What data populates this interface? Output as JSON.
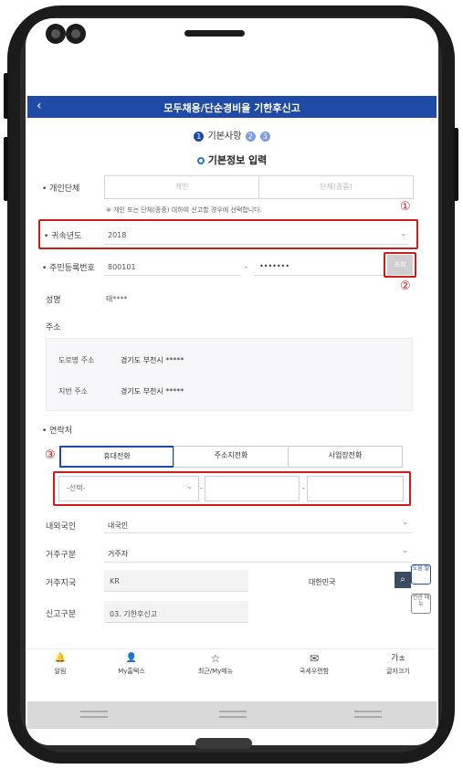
{
  "appbar": {
    "back_icon": "‹",
    "title": "모두채용/단순경비율 기한후신고"
  },
  "stepper": {
    "label": "기본사항",
    "step1": "1",
    "step2": "2",
    "step3": "3"
  },
  "section": {
    "title": "기본정보 입력"
  },
  "form": {
    "type_label": "• 개인단체",
    "type_options": [
      "개인",
      "단체(종중)"
    ],
    "type_note": "※ 개인 또는 단체(종중) 대하여 신고할 경우에 선택합니다.",
    "year_label": "• 귀속년도",
    "year_value": "2018",
    "rrn_label": "• 주민등록번호",
    "rrn_front": "800101",
    "rrn_dash": "-",
    "rrn_back": "•••••••",
    "rrn_button": "조회",
    "name_label": "성명",
    "name_value": "태****",
    "addr_label": "주소",
    "road_label": "도로명 주소",
    "road_value": "경기도 부천시 *****",
    "jibun_label": "지번 주소",
    "jibun_value": "경기도 부천시 *****",
    "contact_label": "• 연락처",
    "contact_tabs": [
      "휴대전화",
      "주소지전화",
      "사업장전화"
    ],
    "phone_select": "-선택-",
    "phone_sep1": "-",
    "phone_sep2": "-",
    "nation_label": "내외국인",
    "nation_value": "내국인",
    "residence_label": "거주구분",
    "residence_value": "거주자",
    "region_label": "거주지국",
    "region_code": "KR",
    "region_name": "대한민국",
    "report_label": "신고구분",
    "report_value": "03. 기한후신고"
  },
  "markers": {
    "m1": "①",
    "m2": "②",
    "m3": "③"
  },
  "side_chips": {
    "help": "도움 말",
    "related": "연관 메뉴"
  },
  "bottom_nav": [
    {
      "icon": "bell-icon",
      "glyph": "🔔",
      "label": "알림"
    },
    {
      "icon": "user-icon",
      "glyph": "👤",
      "label": "My홈택스"
    },
    {
      "icon": "star-icon",
      "glyph": "☆",
      "label": "최근/My메뉴"
    },
    {
      "icon": "mail-icon",
      "glyph": "✉",
      "label": "국세우편함"
    },
    {
      "icon": "font-size-icon",
      "glyph": "가±",
      "label": "글자크기"
    }
  ],
  "colors": {
    "primary": "#1f4aa6",
    "highlight": "#d11a1a"
  }
}
